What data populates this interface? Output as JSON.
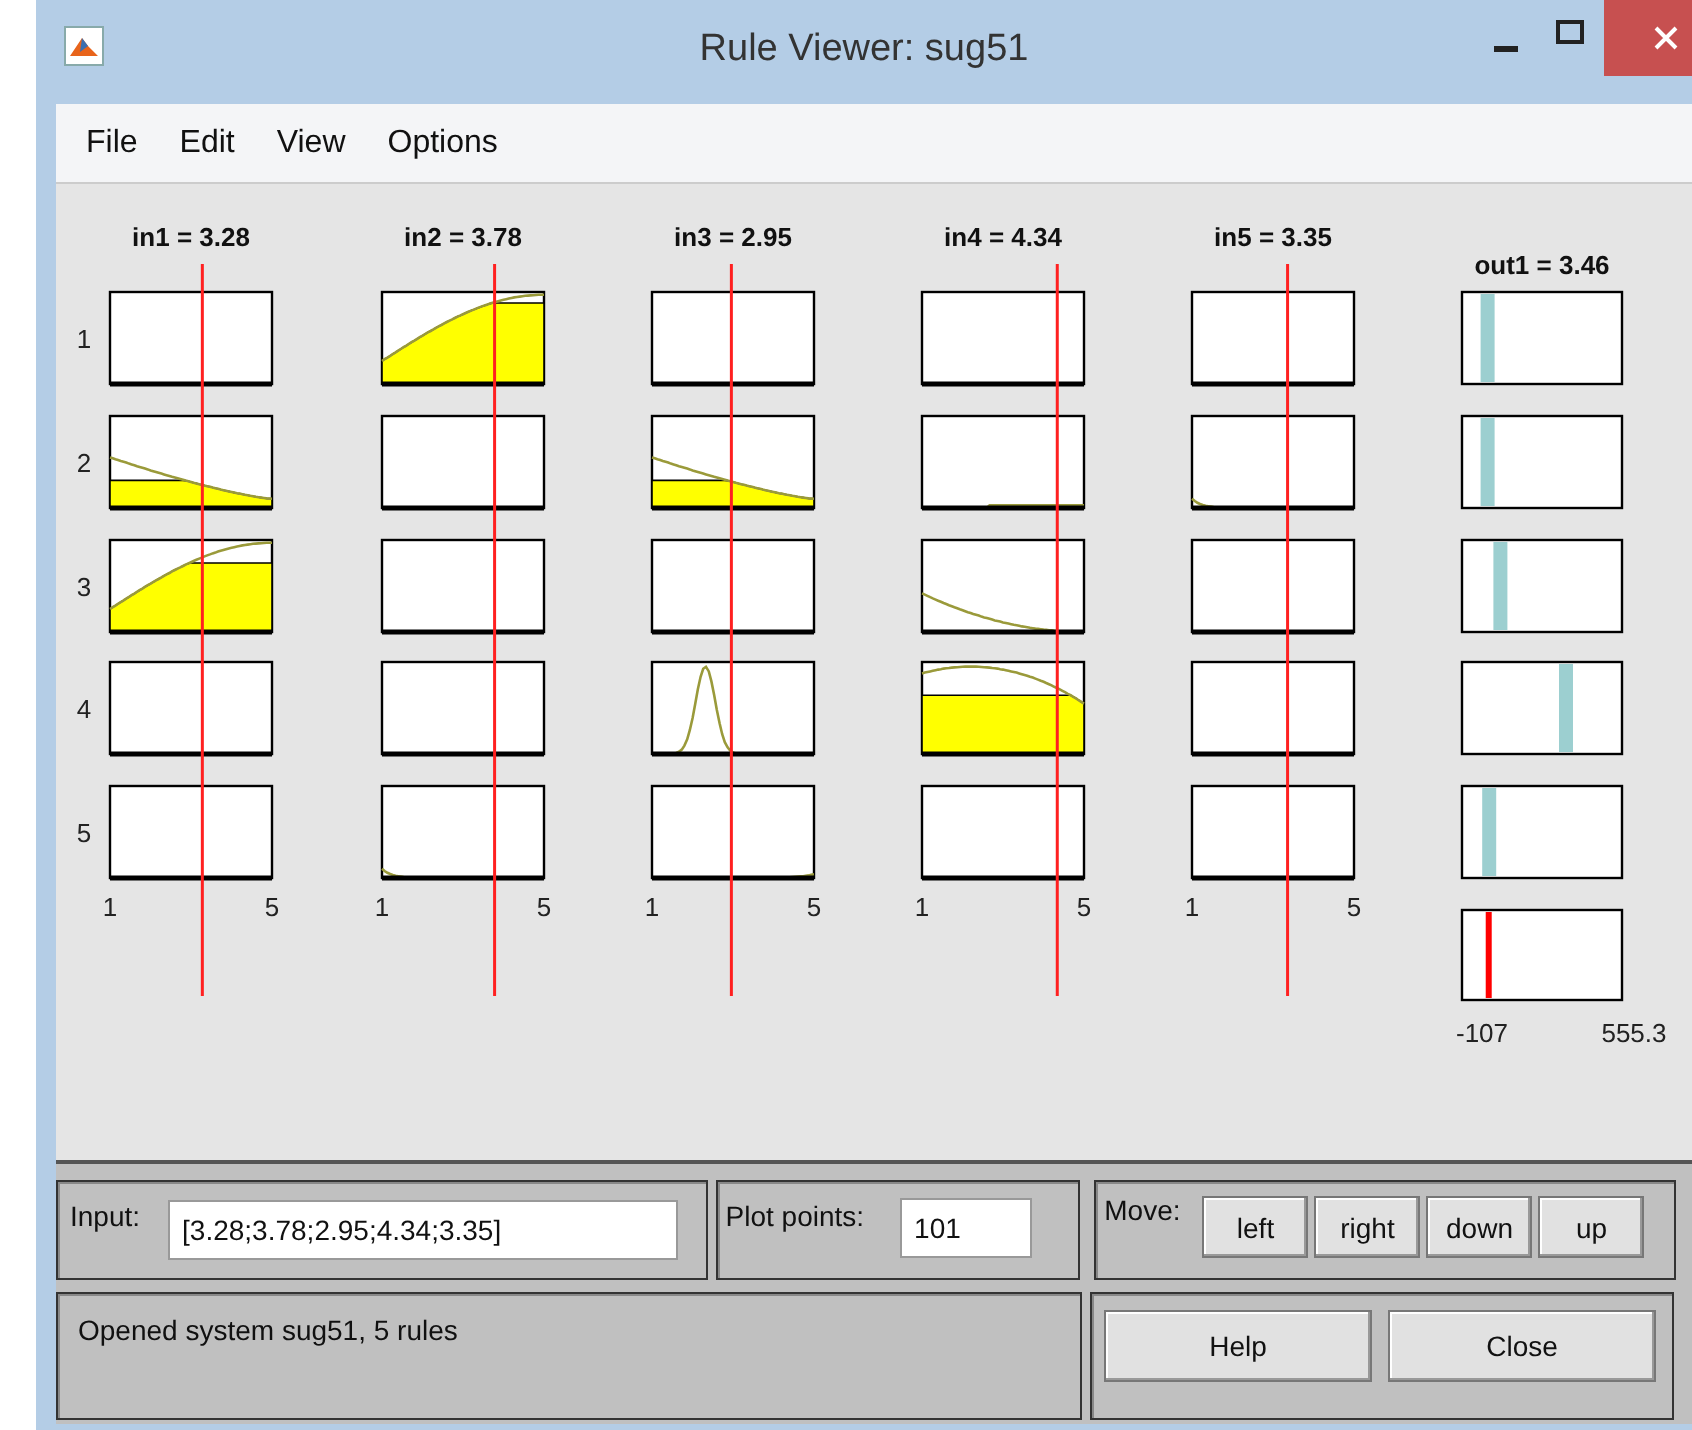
{
  "window": {
    "title": "Rule Viewer: sug51"
  },
  "menu": [
    "File",
    "Edit",
    "View",
    "Options"
  ],
  "rule_numbers": [
    "1",
    "2",
    "3",
    "4",
    "5"
  ],
  "inputs": [
    {
      "title": "in1 = 3.28",
      "axis": [
        "1",
        "5"
      ],
      "rules": [
        {
          "kind": "empty"
        },
        {
          "kind": "fall"
        },
        {
          "kind": "rise"
        },
        {
          "kind": "empty"
        },
        {
          "kind": "empty"
        }
      ]
    },
    {
      "title": "in2 = 3.78",
      "axis": [
        "1",
        "5"
      ],
      "rules": [
        {
          "kind": "rise"
        },
        {
          "kind": "empty"
        },
        {
          "kind": "empty"
        },
        {
          "kind": "empty"
        },
        {
          "kind": "tail-left"
        }
      ]
    },
    {
      "title": "in3 = 2.95",
      "axis": [
        "1",
        "5"
      ],
      "rules": [
        {
          "kind": "empty"
        },
        {
          "kind": "fall"
        },
        {
          "kind": "empty"
        },
        {
          "kind": "peak"
        },
        {
          "kind": "tail-right"
        }
      ]
    },
    {
      "title": "in4 = 4.34",
      "axis": [
        "1",
        "5"
      ],
      "rules": [
        {
          "kind": "empty"
        },
        {
          "kind": "baseline"
        },
        {
          "kind": "decay"
        },
        {
          "kind": "hump"
        },
        {
          "kind": "empty"
        }
      ]
    },
    {
      "title": "in5 = 3.35",
      "axis": [
        "1",
        "5"
      ],
      "rules": [
        {
          "kind": "empty"
        },
        {
          "kind": "tail-left"
        },
        {
          "kind": "empty"
        },
        {
          "kind": "empty"
        },
        {
          "kind": "empty"
        }
      ]
    }
  ],
  "output": {
    "title": "out1 = 3.46",
    "axis": [
      "-107",
      "555.3"
    ]
  },
  "bottom": {
    "input": {
      "label": "Input:",
      "value": "[3.28;3.78;2.95;4.34;3.35]"
    },
    "plot_points": {
      "label": "Plot points:",
      "value": "101"
    },
    "move": {
      "label": "Move:",
      "buttons": [
        "left",
        "right",
        "down",
        "up"
      ]
    },
    "status": "Opened system sug51, 5 rules",
    "buttons": [
      "Help",
      "Close"
    ]
  }
}
